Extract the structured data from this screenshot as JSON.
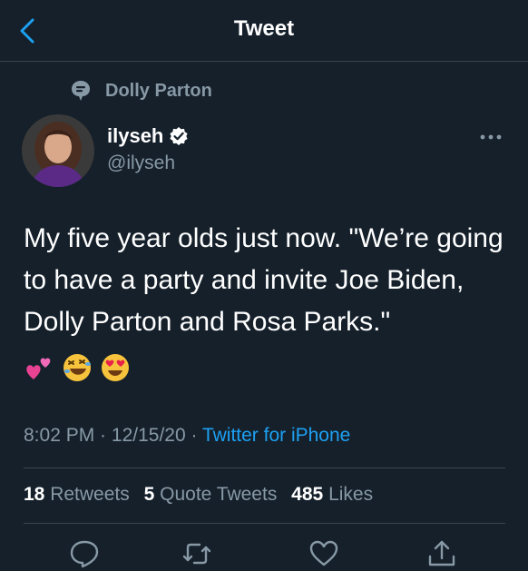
{
  "header": {
    "title": "Tweet"
  },
  "context": {
    "label": "Dolly Parton"
  },
  "author": {
    "name": "ilyseh",
    "handle": "@ilyseh"
  },
  "tweet": {
    "text": "My five year olds just now. \"We’re going to have a party and invite Joe Biden, Dolly Parton and Rosa Parks.\"",
    "emojis": [
      "two-hearts",
      "rolling-laughing",
      "heart-eyes"
    ]
  },
  "meta": {
    "time": "8:02 PM",
    "separator1": " · ",
    "date": "12/15/20",
    "separator2": " · ",
    "source": "Twitter for iPhone"
  },
  "stats": {
    "retweets_count": "18",
    "retweets_label": "Retweets",
    "quotes_count": "5",
    "quotes_label": "Quote Tweets",
    "likes_count": "485",
    "likes_label": "Likes"
  },
  "icons": {
    "back": "chevron-left-icon",
    "context": "topic-speech-bubble-icon",
    "verified": "verified-badge-icon",
    "more": "more-dots-icon",
    "reply": "reply-icon",
    "retweet": "retweet-icon",
    "like": "heart-icon",
    "share": "share-icon"
  },
  "colors": {
    "background": "#15202b",
    "accent": "#1da1f2",
    "secondary_text": "#8899a6",
    "divider": "#38444d"
  }
}
